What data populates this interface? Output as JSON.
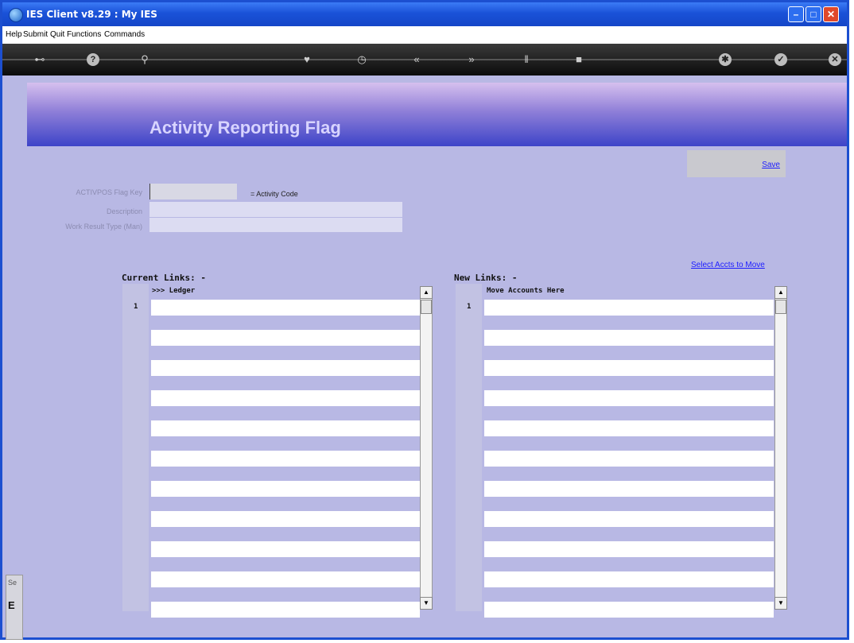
{
  "window": {
    "title": "IES Client v8.29 : My IES"
  },
  "menu": {
    "items": [
      "Help",
      "Submit",
      "Quit",
      "Functions",
      "Commands"
    ]
  },
  "toolbar": {
    "buttons": [
      "key-icon",
      "help-icon",
      "search-icon",
      "heart-icon",
      "clock-icon",
      "rewind-icon",
      "forward-icon",
      "pause-icon",
      "stop-icon",
      "settings-icon",
      "check-icon",
      "close-icon"
    ]
  },
  "page": {
    "title": "Activity Reporting Flag",
    "save_label": "Save"
  },
  "form": {
    "key_label": "ACTIVPOS Flag Key",
    "key_value": "",
    "key_hint": "= Activity Code",
    "description_label": "Description",
    "description_value": "",
    "work_result_label": "Work Result Type (Man)",
    "work_result_value": ""
  },
  "links": {
    "select_label": "Select Accts to Move",
    "current": {
      "title": "Current Links: -",
      "header": ">>> Ledger",
      "first_row": "1"
    },
    "new": {
      "title": "New Links: -",
      "header": "Move Accounts Here",
      "first_row": "1"
    }
  },
  "side_tab": {
    "label_top": "Se",
    "label_bottom": "E"
  },
  "colors": {
    "accent": "#1c4fd0",
    "background": "#b8b8e4",
    "header": "#3d44c8",
    "link": "#1d1dff"
  }
}
